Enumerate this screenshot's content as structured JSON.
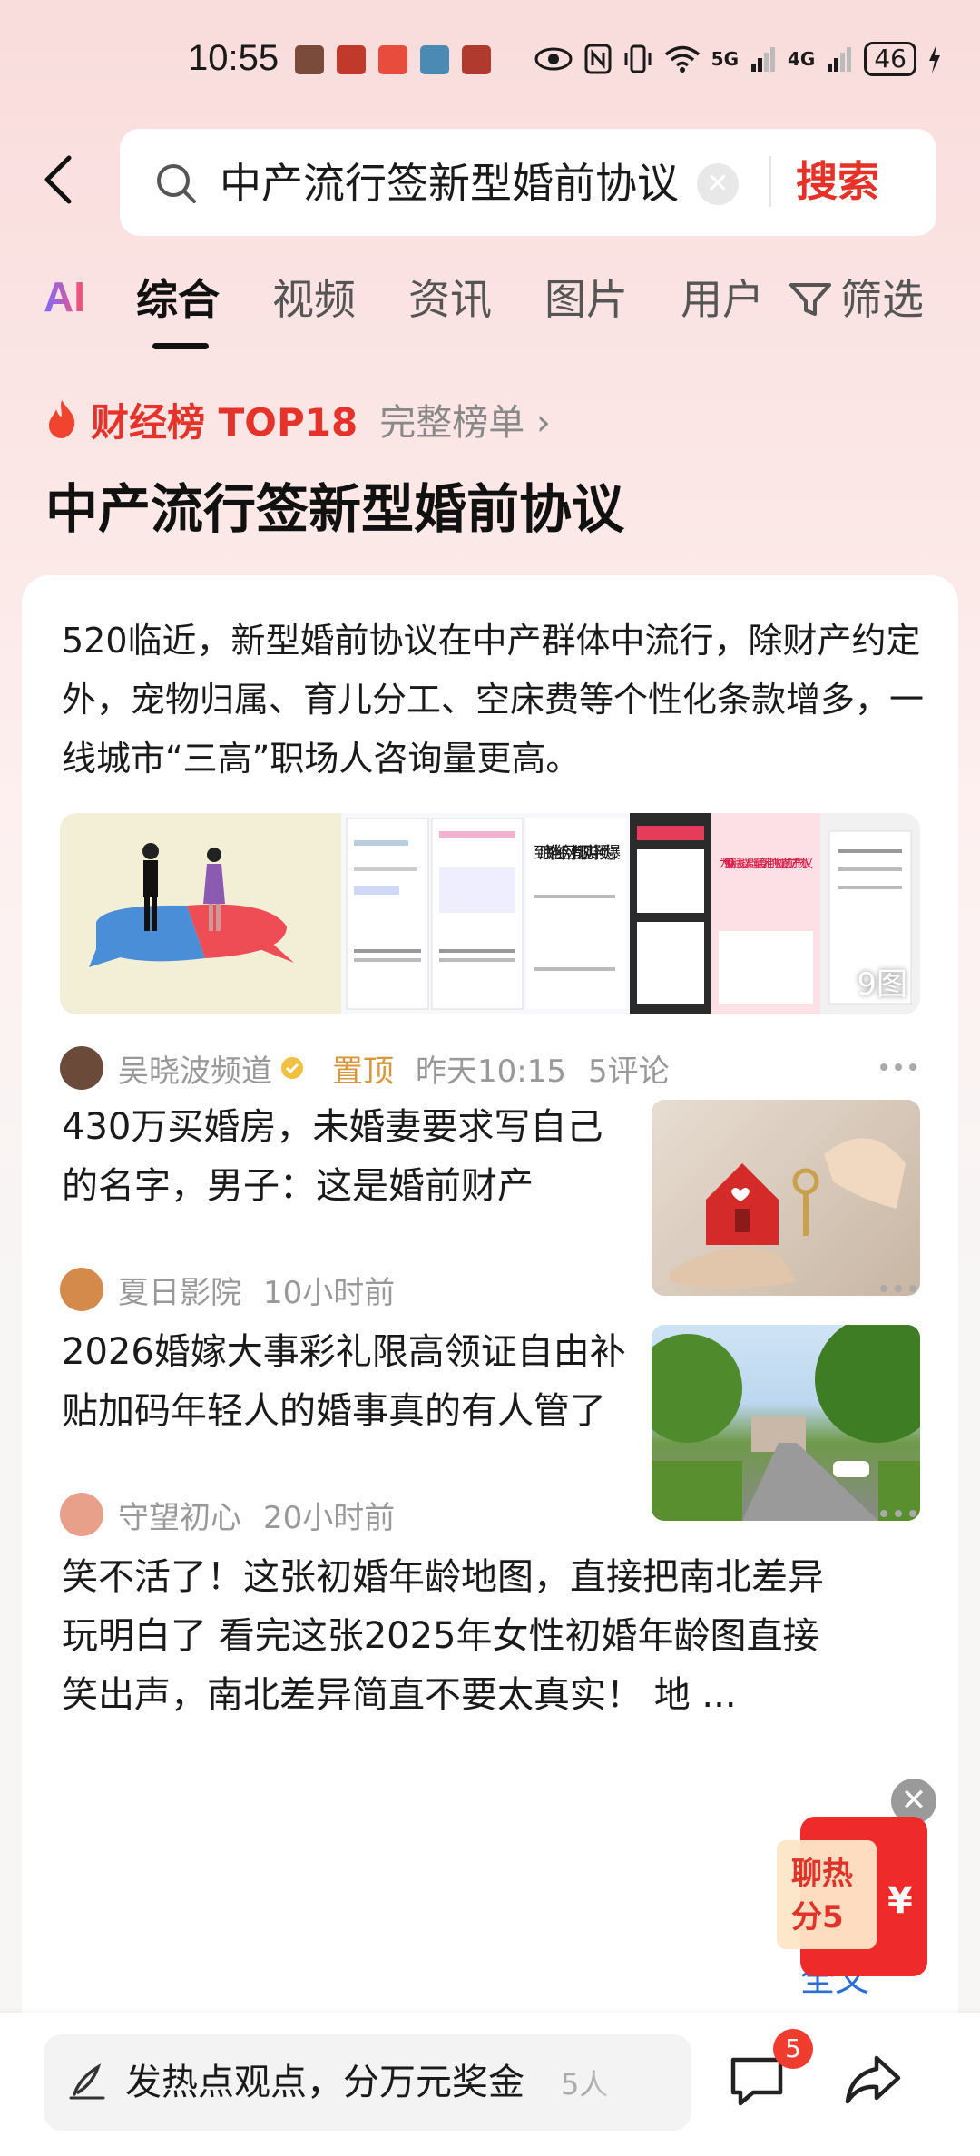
{
  "status_bar": {
    "time": "10:55",
    "battery": "46",
    "net1": "5G",
    "net2": "4G"
  },
  "search": {
    "query": "中产流行签新型婚前协议",
    "button": "搜索"
  },
  "tabs": {
    "ai": "AI",
    "items": [
      "综合",
      "视频",
      "资讯",
      "图片",
      "用户"
    ],
    "filter": "筛选"
  },
  "rank": {
    "label": "财经榜 TOP18",
    "full_list": "完整榜单 ›"
  },
  "topic_title": "中产流行签新型婚前协议",
  "articles": [
    {
      "text": "520临近，新型婚前协议在中产群体中流行，除财产约定外，宠物归属、育儿分工、空床费等个性化条款增多，一线城市“三高”职场人咨询量更高。",
      "image_count": "9图",
      "source": "吴晓波频道",
      "pinned": "置顶",
      "time": "昨天10:15",
      "comments": "5评论",
      "img2_text": "到底谁在给网上都现实中预约爆",
      "img3_text": "为95后/00后适婚人群量身定制的婚前财产协议"
    },
    {
      "title": "430万买婚房，未婚妻要求写自己的名字，男子：这是婚前财产",
      "source": "夏日影院",
      "time": "10小时前"
    },
    {
      "title": "2026婚嫁大事彩礼限高领证自由补贴加码年轻人的婚事真的有人管了",
      "source": "守望初心",
      "time": "20小时前"
    },
    {
      "title": "笑不活了！这张初婚年龄地图，直接把南北差异玩明白了 看完这张2025年女性初婚年龄图直接笑出声，南北差异简直不要太真实！ 地 ...",
      "read_more": "全文"
    }
  ],
  "float_ad": {
    "line1": "聊热",
    "line2": "分5",
    "symbol": "¥"
  },
  "bottom": {
    "placeholder": "发热点观点，分万元奖金",
    "count": "5人",
    "badge": "5"
  },
  "colors": {
    "accent": "#e53228",
    "pin": "#d9963a",
    "link": "#2a6fd6"
  }
}
